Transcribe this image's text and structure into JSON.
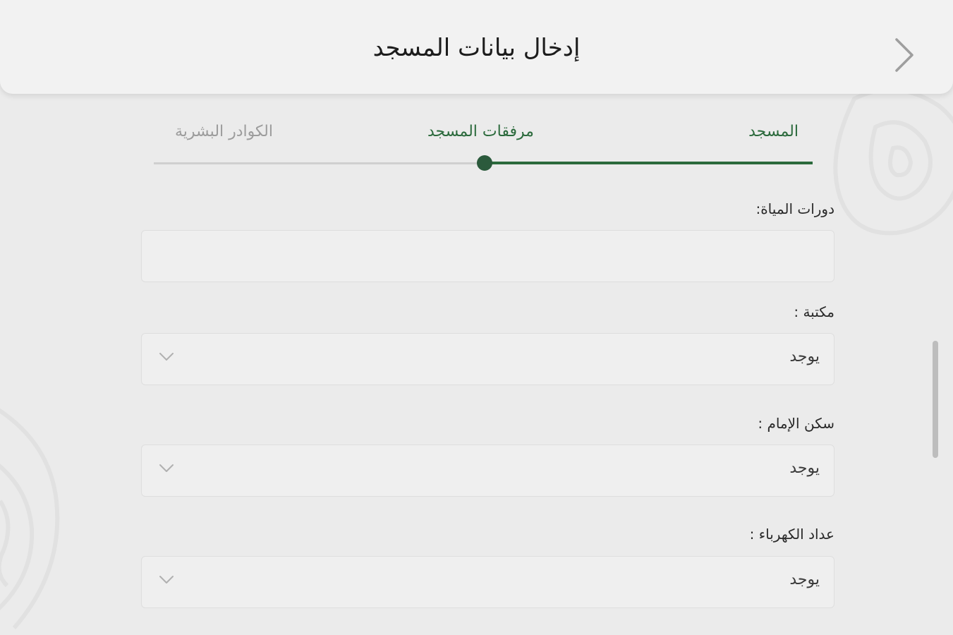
{
  "header": {
    "title": "إدخال بيانات المسجد"
  },
  "stepper": {
    "steps": [
      {
        "label": "المسجد",
        "state": "completed"
      },
      {
        "label": "مرفقات المسجد",
        "state": "active"
      },
      {
        "label": "الكوادر البشرية",
        "state": "pending"
      }
    ],
    "progress_fraction": 0.5
  },
  "form": {
    "washrooms": {
      "label": "دورات المياة:",
      "value": ""
    },
    "library": {
      "label": "مكتبة :",
      "value": "يوجد"
    },
    "imam_housing": {
      "label": "سكن الإمام :",
      "value": "يوجد"
    },
    "electric_meter": {
      "label": "عداد الكهرباء :",
      "value": "يوجد"
    }
  },
  "colors": {
    "accent": "#2b6a3c",
    "background": "#ebebeb",
    "header_bg": "#f2f2f2",
    "inactive_text": "#9c9c9c"
  },
  "icons": {
    "back": "chevron-right-icon",
    "dropdown": "chevron-down-icon"
  }
}
